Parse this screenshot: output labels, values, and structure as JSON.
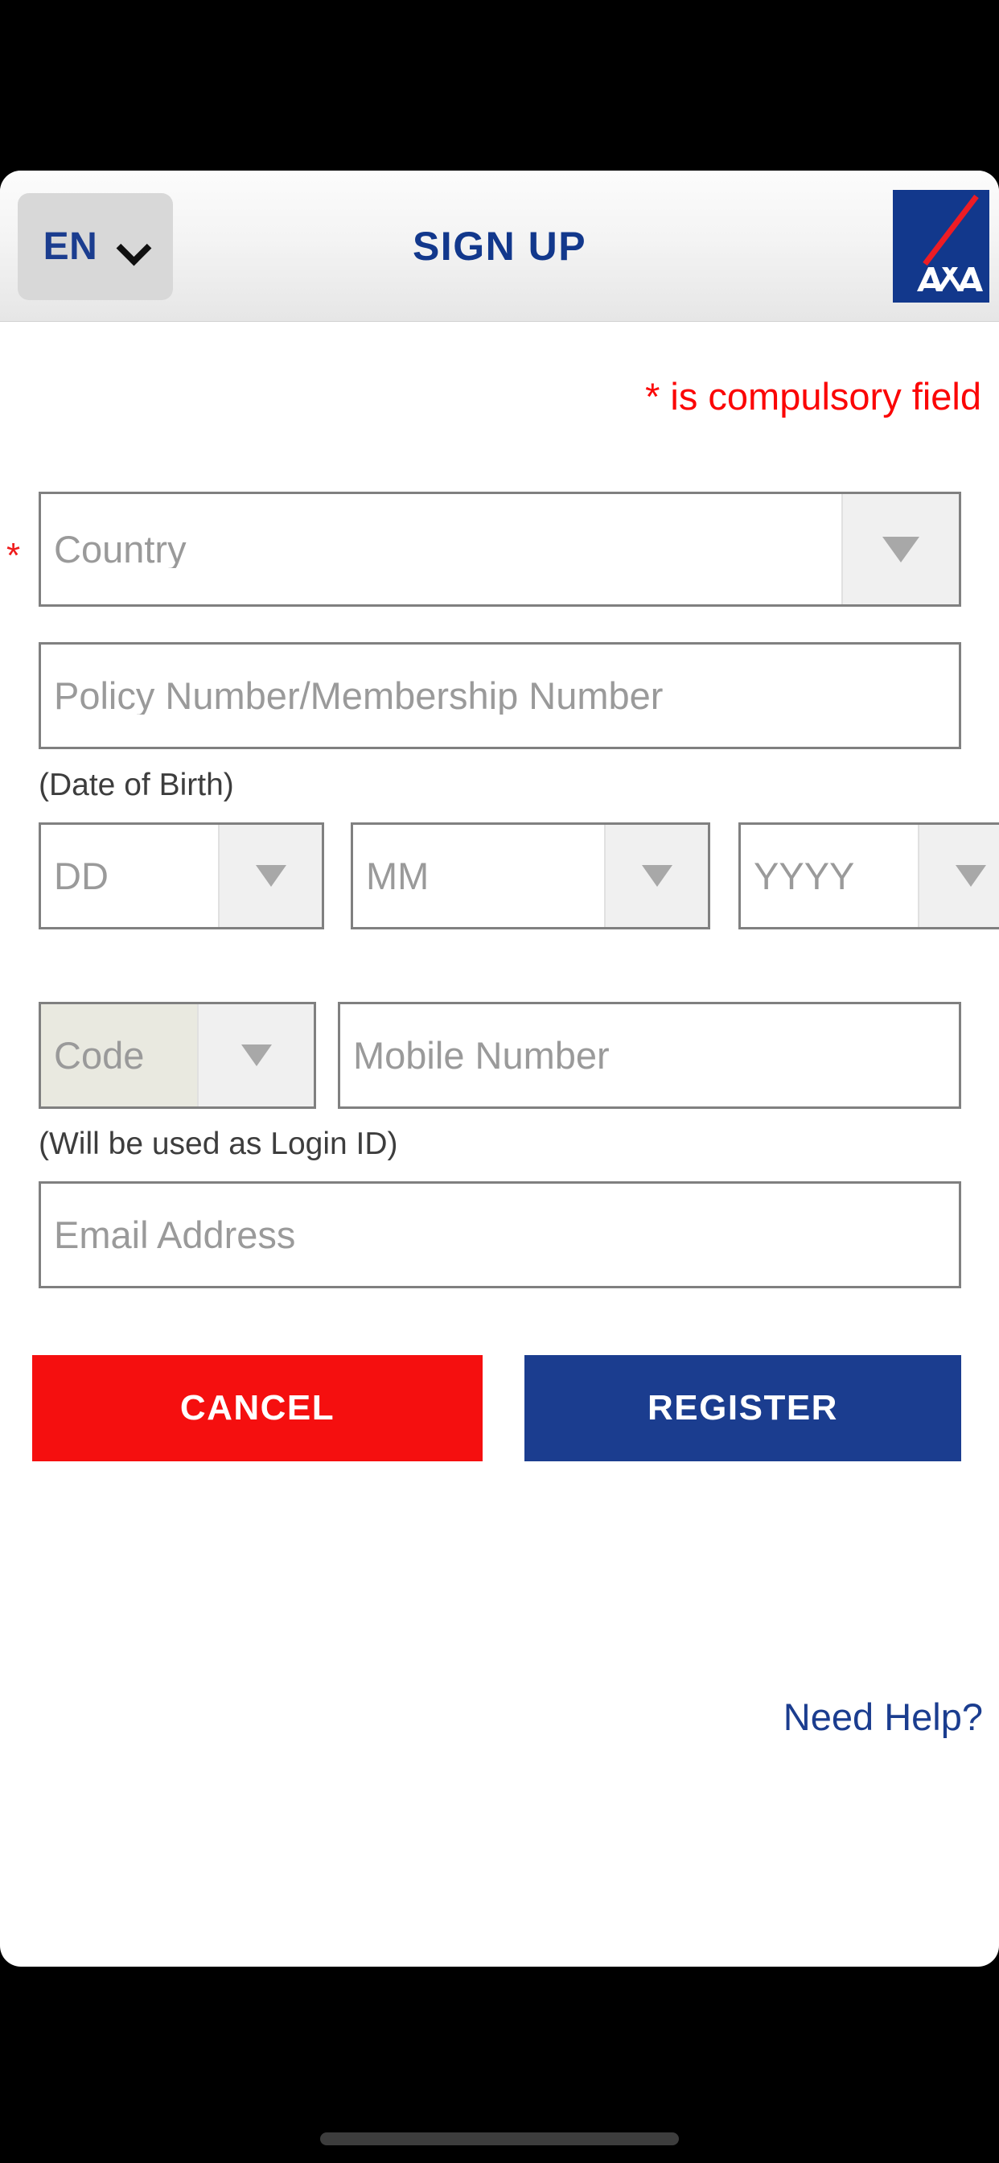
{
  "header": {
    "language_code": "EN",
    "language_chevron_icon": "chevron-down-icon",
    "title": "SIGN UP",
    "logo_text": "AXA"
  },
  "form": {
    "compulsory_note": "* is compulsory field",
    "required_marker": "*",
    "country": {
      "placeholder": "Country",
      "arrow_icon": "triangle-down-icon"
    },
    "policy_number": {
      "placeholder": "Policy Number/Membership Number"
    },
    "dob": {
      "label": "(Date of Birth)",
      "day_placeholder": "DD",
      "month_placeholder": "MM",
      "year_placeholder": "YYYY"
    },
    "mobile": {
      "code_placeholder": "Code",
      "number_placeholder": "Mobile Number"
    },
    "email": {
      "label": "(Will be used as Login ID)",
      "placeholder": "Email Address"
    }
  },
  "actions": {
    "cancel_label": "CANCEL",
    "register_label": "REGISTER",
    "need_help_label": "Need Help?"
  },
  "colors": {
    "brand_navy": "#1b3d8f",
    "brand_red": "#f50f0f",
    "alert_red": "#fb0505",
    "field_border": "#808080",
    "placeholder_grey": "#9a9a9a"
  }
}
